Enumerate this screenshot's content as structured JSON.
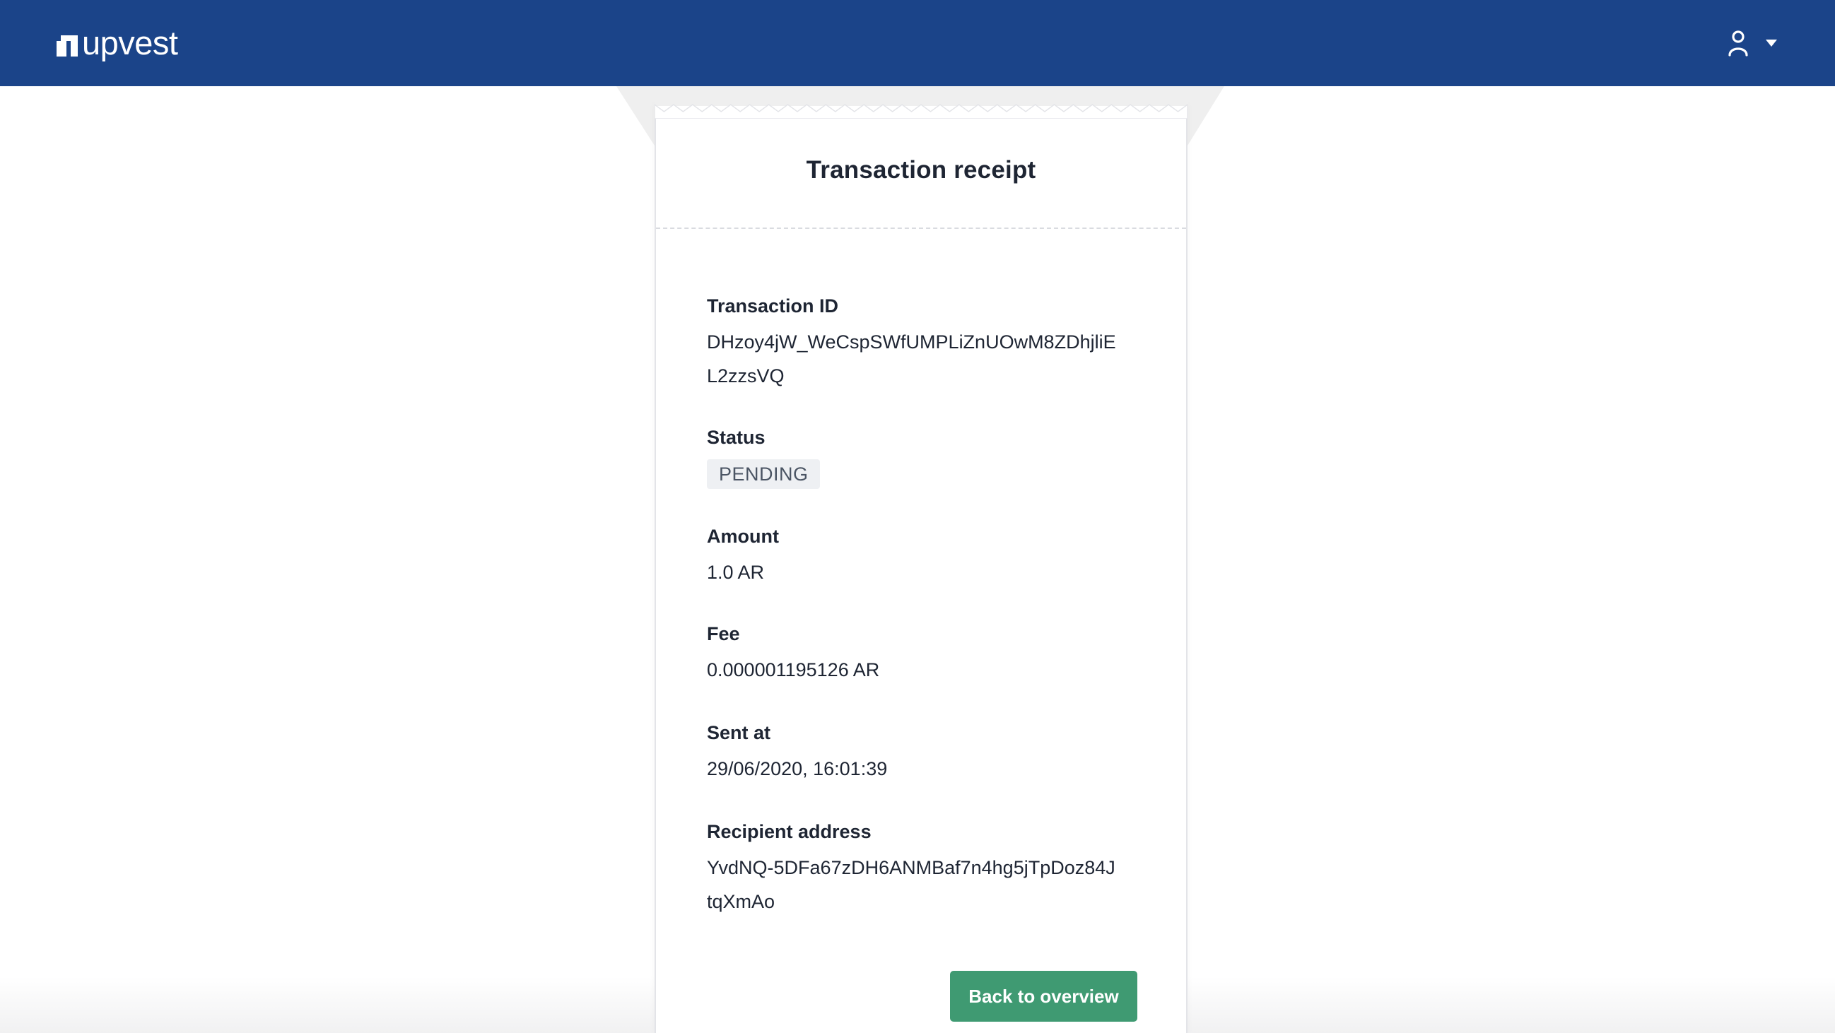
{
  "header": {
    "brand_name": "upvest",
    "colors": {
      "background": "#1b4489",
      "foreground": "#ffffff"
    },
    "icons": {
      "logo": "upvest-logo-icon",
      "user": "user-icon",
      "caret": "caret-down-icon"
    }
  },
  "receipt": {
    "title": "Transaction receipt",
    "transaction_id": {
      "label": "Transaction ID",
      "value_line1": "DHzoy4jW_WeCspSWfUMPLiZnUOwM8ZDhjliE",
      "value_line2": "L2zzsVQ"
    },
    "status": {
      "label": "Status",
      "value": "PENDING"
    },
    "amount": {
      "label": "Amount",
      "value": "1.0 AR"
    },
    "fee": {
      "label": "Fee",
      "value": "0.000001195126 AR"
    },
    "sent_at": {
      "label": "Sent at",
      "value": "29/06/2020, 16:01:39"
    },
    "recipient_address": {
      "label": "Recipient address",
      "value_line1": "YvdNQ-5DFa67zDH6ANMBaf7n4hg5jTpDoz84J",
      "value_line2": "tqXmAo"
    },
    "back_button_label": "Back to overview",
    "colors": {
      "button": "#3f9a72",
      "badge_bg": "#eef0f3",
      "badge_text": "#4b5564"
    }
  }
}
